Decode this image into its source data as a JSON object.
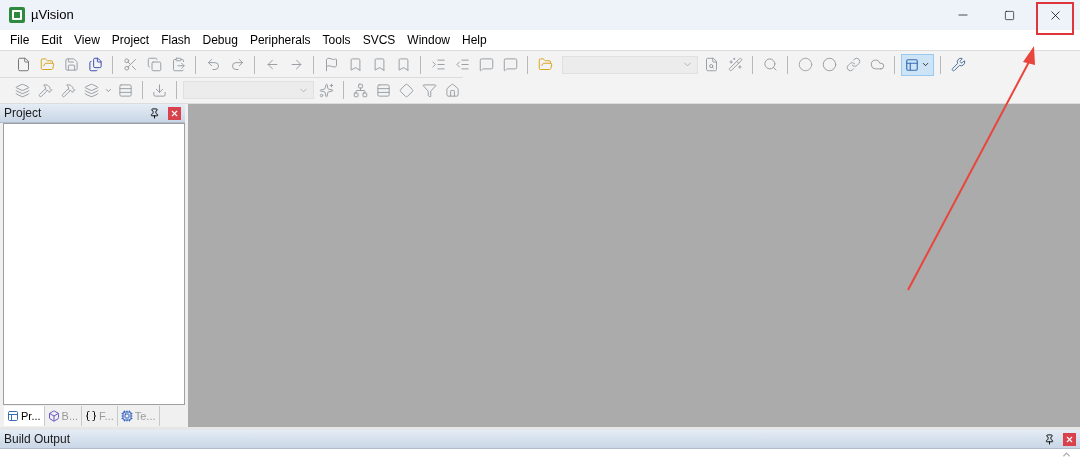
{
  "window": {
    "title": "µVision"
  },
  "menu": [
    "File",
    "Edit",
    "View",
    "Project",
    "Flash",
    "Debug",
    "Peripherals",
    "Tools",
    "SVCS",
    "Window",
    "Help"
  ],
  "project_panel": {
    "title": "Project",
    "tabs": [
      {
        "label": "Pr...",
        "selected": true
      },
      {
        "label": "B...",
        "selected": false
      },
      {
        "label": "F...",
        "selected": false
      },
      {
        "label": "Te...",
        "selected": false
      }
    ]
  },
  "build_output": {
    "title": "Build Output"
  }
}
